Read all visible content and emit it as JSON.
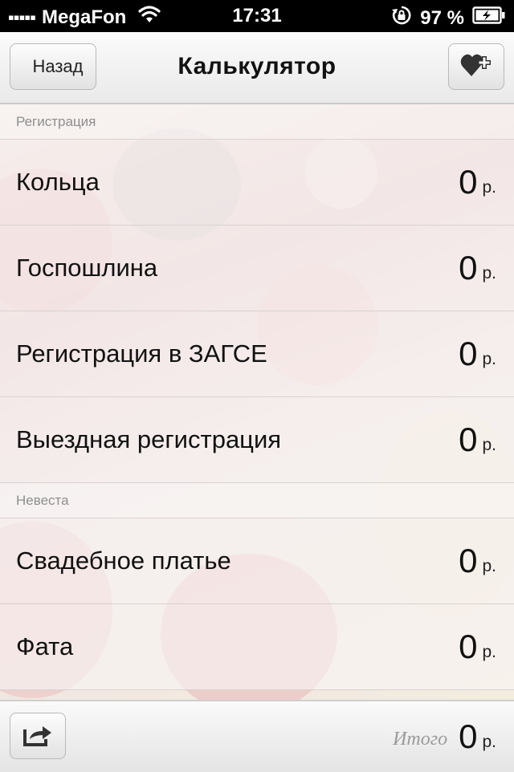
{
  "status_bar": {
    "signal": "▪▪▪▪▪",
    "carrier": "MegaFon",
    "time": "17:31",
    "battery": "97 %"
  },
  "nav": {
    "back_label": "Назад",
    "title": "Калькулятор"
  },
  "sections": [
    {
      "header": "Регистрация",
      "rows": [
        {
          "label": "Кольца",
          "value": "0",
          "currency": "р."
        },
        {
          "label": "Госпошлина",
          "value": "0",
          "currency": "р."
        },
        {
          "label": "Регистрация в ЗАГСЕ",
          "value": "0",
          "currency": "р."
        },
        {
          "label": "Выездная регистрация",
          "value": "0",
          "currency": "р."
        }
      ]
    },
    {
      "header": "Невеста",
      "rows": [
        {
          "label": "Свадебное платье",
          "value": "0",
          "currency": "р."
        },
        {
          "label": "Фата",
          "value": "0",
          "currency": "р."
        }
      ]
    }
  ],
  "footer": {
    "total_label": "Итого",
    "total_value": "0",
    "currency": "р."
  },
  "icons": {
    "back": "chevron-left-icon",
    "favorite_add": "heart-plus-icon",
    "share": "share-icon",
    "wifi": "wifi-icon",
    "lock_rotation": "rotation-lock-icon",
    "battery": "battery-charging-icon"
  }
}
